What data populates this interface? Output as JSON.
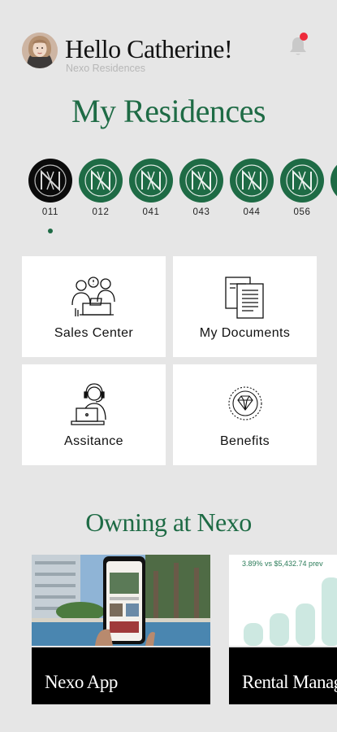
{
  "header": {
    "greeting": "Hello Catherine!",
    "subtitle": "Nexo Residences",
    "notification_indicator": true
  },
  "residences": {
    "title": "My Residences",
    "items": [
      {
        "label": "011",
        "active": true
      },
      {
        "label": "012",
        "active": false
      },
      {
        "label": "041",
        "active": false
      },
      {
        "label": "043",
        "active": false
      },
      {
        "label": "044",
        "active": false
      },
      {
        "label": "056",
        "active": false
      }
    ]
  },
  "tiles": [
    {
      "label": "Sales Center",
      "icon": "sales-center-icon"
    },
    {
      "label": "My Documents",
      "icon": "documents-icon"
    },
    {
      "label": "Assitance",
      "icon": "assistance-icon"
    },
    {
      "label": "Benefits",
      "icon": "benefits-icon"
    }
  ],
  "owning": {
    "title": "Owning at Nexo",
    "cards": [
      {
        "label": "Nexo App"
      },
      {
        "label": "Rental Manag",
        "stat": "3.89% vs $5,432.74 prev"
      }
    ]
  },
  "colors": {
    "brand_green": "#1e6b45",
    "background": "#e6e6e6",
    "notification_red": "#ee2b3b"
  }
}
